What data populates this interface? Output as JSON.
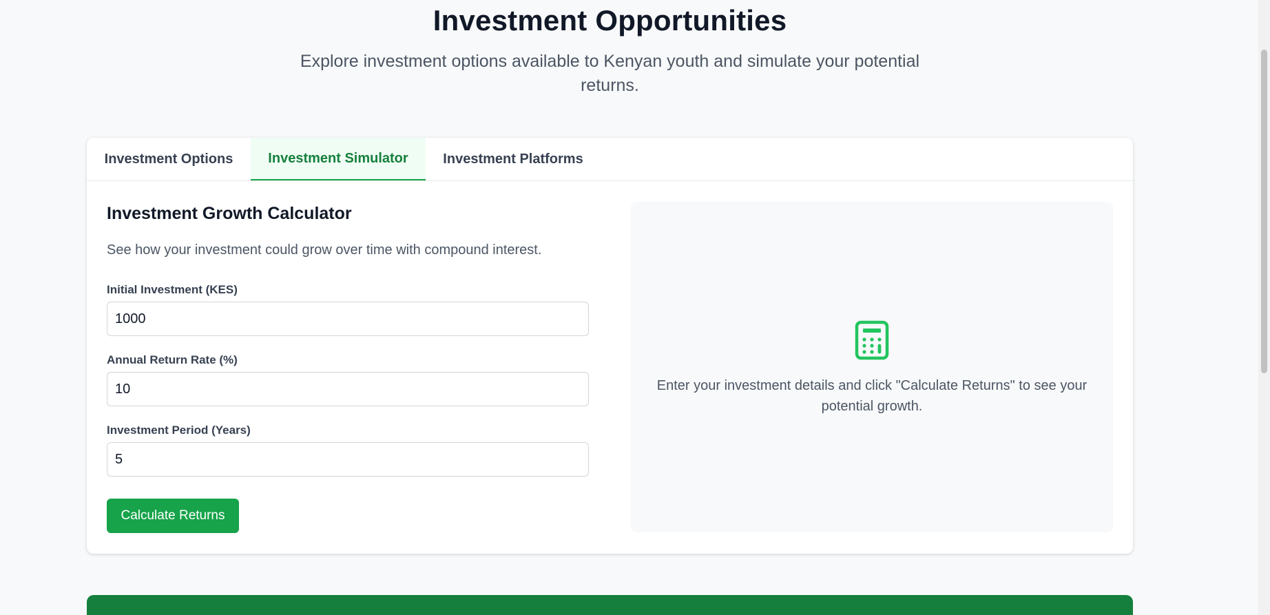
{
  "header": {
    "title": "Investment Opportunities",
    "subtitle": "Explore investment options available to Kenyan youth and simulate your potential returns."
  },
  "tabs": [
    {
      "label": "Investment Options",
      "active": false
    },
    {
      "label": "Investment Simulator",
      "active": true
    },
    {
      "label": "Investment Platforms",
      "active": false
    }
  ],
  "calculator": {
    "title": "Investment Growth Calculator",
    "description": "See how your investment could grow over time with compound interest.",
    "fields": [
      {
        "label": "Initial Investment (KES)",
        "value": "1000"
      },
      {
        "label": "Annual Return Rate (%)",
        "value": "10"
      },
      {
        "label": "Investment Period (Years)",
        "value": "5"
      }
    ],
    "button_label": "Calculate Returns"
  },
  "result_panel": {
    "icon": "calculator-icon",
    "message": "Enter your investment details and click \"Calculate Returns\" to see your potential growth."
  },
  "colors": {
    "accent": "#16a34a",
    "accent_dark": "#15803d",
    "active_tab_bg": "#f0fdf4",
    "page_bg": "#f8f9fa"
  }
}
